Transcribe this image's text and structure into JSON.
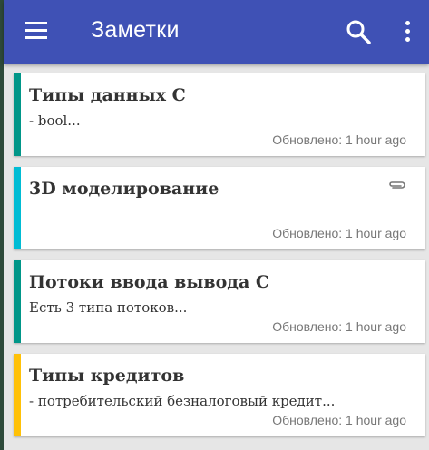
{
  "app": {
    "title": "Заметки",
    "accent_color": "#3f51b5"
  },
  "toolbar": {
    "menu_icon": "menu-icon",
    "search_icon": "search-icon",
    "more_icon": "more-vert-icon"
  },
  "notes": [
    {
      "title": " Типы данных С",
      "preview": "- bool...",
      "updated": "Обновлено: 1 hour ago",
      "color": "#009688",
      "has_attachment": false
    },
    {
      "title": "3D моделирование",
      "preview": "",
      "updated": "Обновлено: 1 hour ago",
      "color": "#00bcd4",
      "has_attachment": true
    },
    {
      "title": "Потоки ввода вывода С",
      "preview": "Есть 3 типа потоков...",
      "updated": "Обновлено: 1 hour ago",
      "color": "#009688",
      "has_attachment": false
    },
    {
      "title": "Типы кредитов",
      "preview": "- потребительский безналоговый кредит...",
      "updated": "Обновлено: 1 hour ago",
      "color": "#ffc107",
      "has_attachment": false
    }
  ]
}
